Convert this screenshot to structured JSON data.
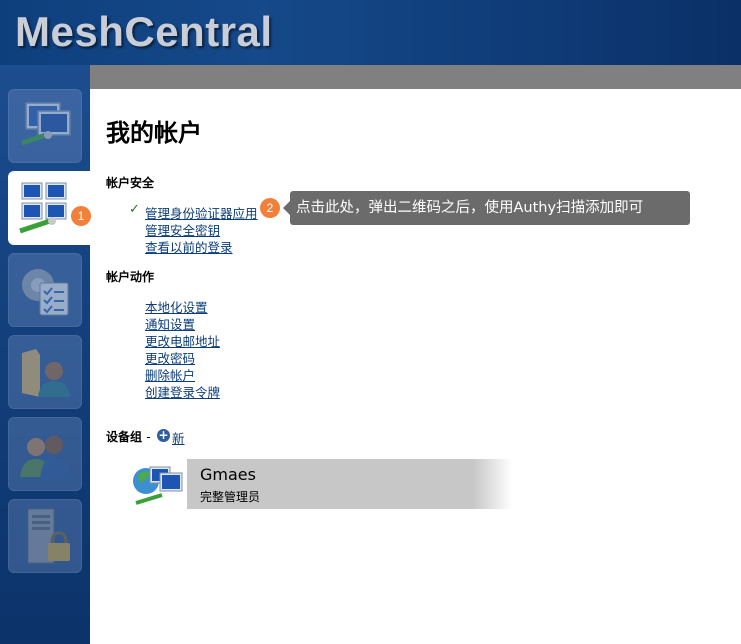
{
  "header": {
    "logo": "MeshCentral"
  },
  "sidebar": {
    "tiles": [
      {
        "name": "my-devices",
        "icon": "computers-icon"
      },
      {
        "name": "my-account",
        "icon": "account-computers-icon",
        "active": true
      },
      {
        "name": "my-events",
        "icon": "settings-list-icon"
      },
      {
        "name": "my-files",
        "icon": "folder-user-icon"
      },
      {
        "name": "my-users",
        "icon": "users-icon"
      },
      {
        "name": "my-server",
        "icon": "server-lock-icon"
      }
    ]
  },
  "badges": {
    "one": "1",
    "two": "2"
  },
  "main": {
    "title": "我的帐户",
    "security": {
      "title": "帐户安全",
      "check": "✓",
      "links": [
        "管理身份验证器应用",
        "管理安全密钥",
        "查看以前的登录"
      ]
    },
    "actions": {
      "title": "帐户动作",
      "links": [
        "本地化设置",
        "通知设置",
        "更改电邮地址",
        "更改密码",
        "删除帐户",
        "创建登录令牌"
      ]
    },
    "groups": {
      "title": "设备组",
      "separator": "-",
      "plus": "+",
      "new_label": "新",
      "device": {
        "name": "Gmaes",
        "role": "完整管理员"
      }
    },
    "tooltip": "点击此处，弹出二维码之后，使用Authy扫描添加即可"
  },
  "colors": {
    "header": "#0e3f7d",
    "sidebar": "#123f7a",
    "badge": "#f0803a",
    "tooltip": "#6b6b6b",
    "link": "#0b3d7a"
  }
}
